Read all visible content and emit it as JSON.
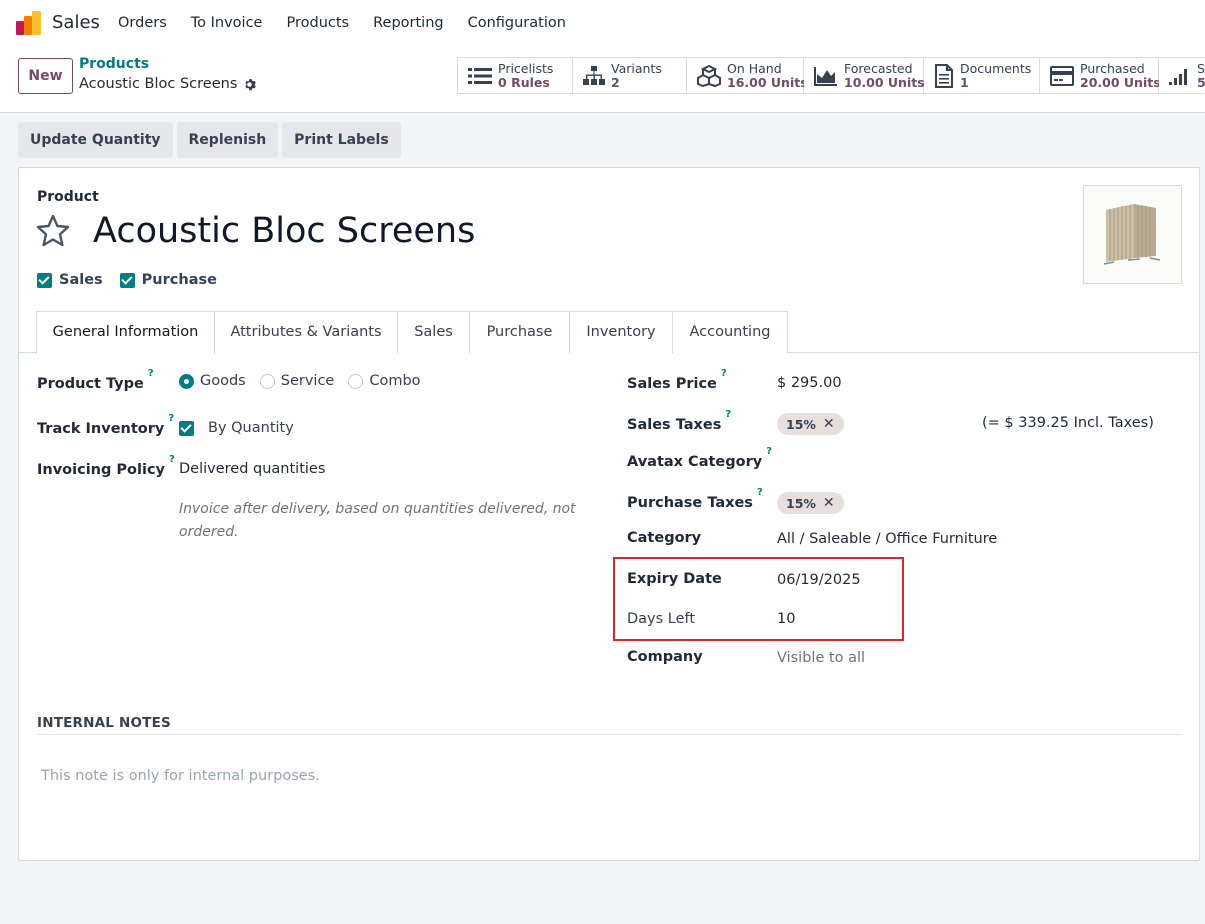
{
  "navbar": {
    "app_name": "Sales",
    "menu": [
      "Orders",
      "To Invoice",
      "Products",
      "Reporting",
      "Configuration"
    ]
  },
  "control_panel": {
    "new_label": "New",
    "breadcrumb_parent": "Products",
    "breadcrumb_current": "Acoustic Bloc Screens"
  },
  "smart_buttons": [
    {
      "icon": "list-icon",
      "label": "Pricelists",
      "value": "0",
      "unit": "Rules"
    },
    {
      "icon": "sitemap-icon",
      "label": "Variants",
      "value": "2",
      "unit": ""
    },
    {
      "icon": "cubes-icon",
      "label": "On Hand",
      "value": "16.00",
      "unit": "Units"
    },
    {
      "icon": "area-chart-icon",
      "label": "Forecasted",
      "value": "10.00",
      "unit": "Units"
    },
    {
      "icon": "file-icon",
      "label": "Documents",
      "value": "1",
      "unit": ""
    },
    {
      "icon": "credit-card-icon",
      "label": "Purchased",
      "value": "20.00",
      "unit": "Units"
    },
    {
      "icon": "signal-icon",
      "label": "S",
      "value": "5",
      "unit": ""
    }
  ],
  "actions": {
    "update_quantity": "Update Quantity",
    "replenish": "Replenish",
    "print_labels": "Print Labels"
  },
  "form": {
    "product_label": "Product",
    "product_name": "Acoustic Bloc Screens",
    "can_be_sold": "Sales",
    "can_be_purchased": "Purchase",
    "tabs": [
      "General Information",
      "Attributes & Variants",
      "Sales",
      "Purchase",
      "Inventory",
      "Accounting"
    ],
    "active_tab": "General Information",
    "left": {
      "product_type_label": "Product Type",
      "product_type_options": [
        "Goods",
        "Service",
        "Combo"
      ],
      "product_type_selected": "Goods",
      "track_inventory_label": "Track Inventory",
      "track_inventory_value": "By Quantity",
      "invoicing_policy_label": "Invoicing Policy",
      "invoicing_policy_value": "Delivered quantities",
      "invoicing_policy_note": "Invoice after delivery, based on quantities delivered, not ordered."
    },
    "right": {
      "sales_price_label": "Sales Price",
      "sales_price_value": "$ 295.00",
      "sales_taxes_label": "Sales Taxes",
      "sales_taxes_tag": "15%",
      "sales_taxes_incl": "(= $ 339.25 Incl. Taxes)",
      "avatax_label": "Avatax Category",
      "purchase_taxes_label": "Purchase Taxes",
      "purchase_taxes_tag": "15%",
      "category_label": "Category",
      "category_value": "All / Saleable / Office Furniture",
      "expiry_label": "Expiry Date",
      "expiry_value": "06/19/2025",
      "days_left_label": "Days Left",
      "days_left_value": "10",
      "company_label": "Company",
      "company_value": "Visible to all"
    },
    "internal_notes_heading": "INTERNAL NOTES",
    "internal_notes_placeholder": "This note is only for internal purposes.",
    "help_mark": "?"
  },
  "colors": {
    "brand": "#714b67",
    "accent": "#017e84",
    "highlight": "#dc2626"
  }
}
